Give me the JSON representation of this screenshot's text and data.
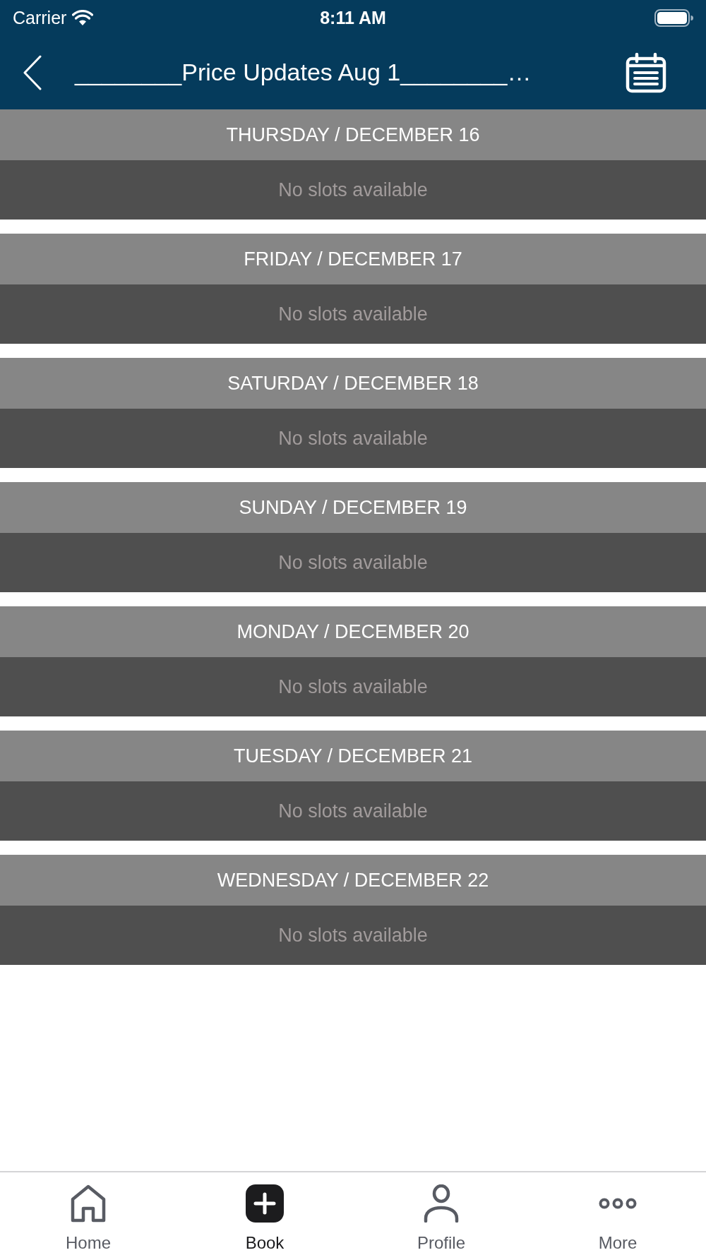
{
  "status_bar": {
    "carrier": "Carrier",
    "time": "8:11 AM"
  },
  "nav_bar": {
    "title": "________Price Updates Aug 1________…"
  },
  "days": [
    {
      "heading": "THURSDAY / DECEMBER 16",
      "message": "No slots available"
    },
    {
      "heading": "FRIDAY / DECEMBER 17",
      "message": "No slots available"
    },
    {
      "heading": "SATURDAY / DECEMBER 18",
      "message": "No slots available"
    },
    {
      "heading": "SUNDAY / DECEMBER 19",
      "message": "No slots available"
    },
    {
      "heading": "MONDAY / DECEMBER 20",
      "message": "No slots available"
    },
    {
      "heading": "TUESDAY / DECEMBER 21",
      "message": "No slots available"
    },
    {
      "heading": "WEDNESDAY / DECEMBER 22",
      "message": "No slots available"
    }
  ],
  "tab_bar": [
    {
      "kind": "home",
      "label": "Home",
      "selected": false
    },
    {
      "kind": "book",
      "label": "Book",
      "selected": true
    },
    {
      "kind": "profile",
      "label": "Profile",
      "selected": false
    },
    {
      "kind": "more",
      "label": "More",
      "selected": false
    }
  ]
}
